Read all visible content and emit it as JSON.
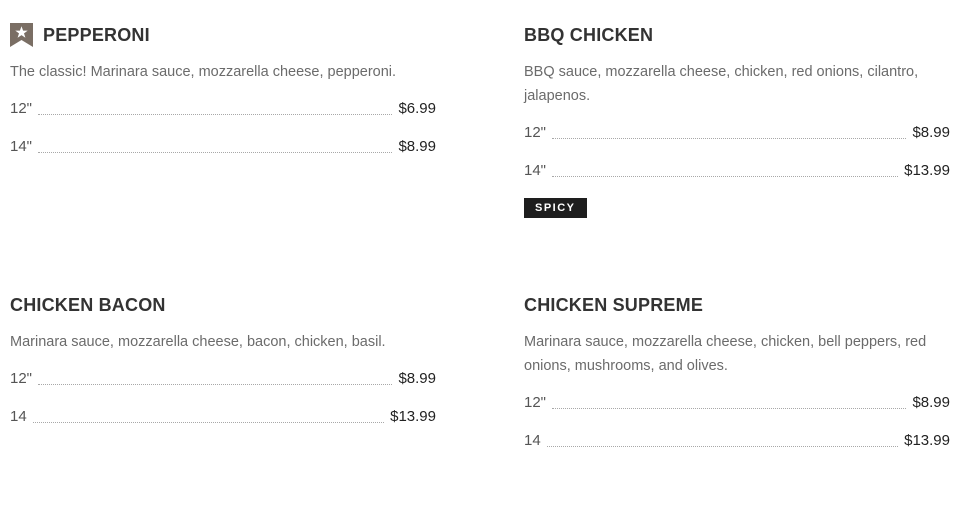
{
  "menu": {
    "items": [
      {
        "name": "PEPPERONI",
        "featured": true,
        "description": "The classic! Marinara sauce, mozzarella cheese, pepperoni.",
        "prices": [
          {
            "size": "12\"",
            "price": "$6.99"
          },
          {
            "size": "14\"",
            "price": "$8.99"
          }
        ]
      },
      {
        "name": "BBQ CHICKEN",
        "description": "BBQ sauce, mozzarella cheese, chicken, red onions, cilantro, jalapenos.",
        "prices": [
          {
            "size": "12\"",
            "price": "$8.99"
          },
          {
            "size": "14\"",
            "price": "$13.99"
          }
        ],
        "tag": "SPICY"
      },
      {
        "name": "CHICKEN BACON",
        "description": "Marinara sauce, mozzarella cheese, bacon, chicken, basil.",
        "prices": [
          {
            "size": "12\"",
            "price": "$8.99"
          },
          {
            "size": "14",
            "price": "$13.99"
          }
        ]
      },
      {
        "name": "CHICKEN SUPREME",
        "description": "Marinara sauce, mozzarella cheese, chicken, bell peppers, red onions, mushrooms, and olives.",
        "prices": [
          {
            "size": "12\"",
            "price": "$8.99"
          },
          {
            "size": "14",
            "price": "$13.99"
          }
        ]
      }
    ]
  },
  "colors": {
    "text": "#333333",
    "description": "#6b6b6b",
    "badge": "#7a6e64",
    "tag_bg": "#1e1e1e"
  },
  "icons": {
    "featured": "star-ribbon-icon"
  }
}
